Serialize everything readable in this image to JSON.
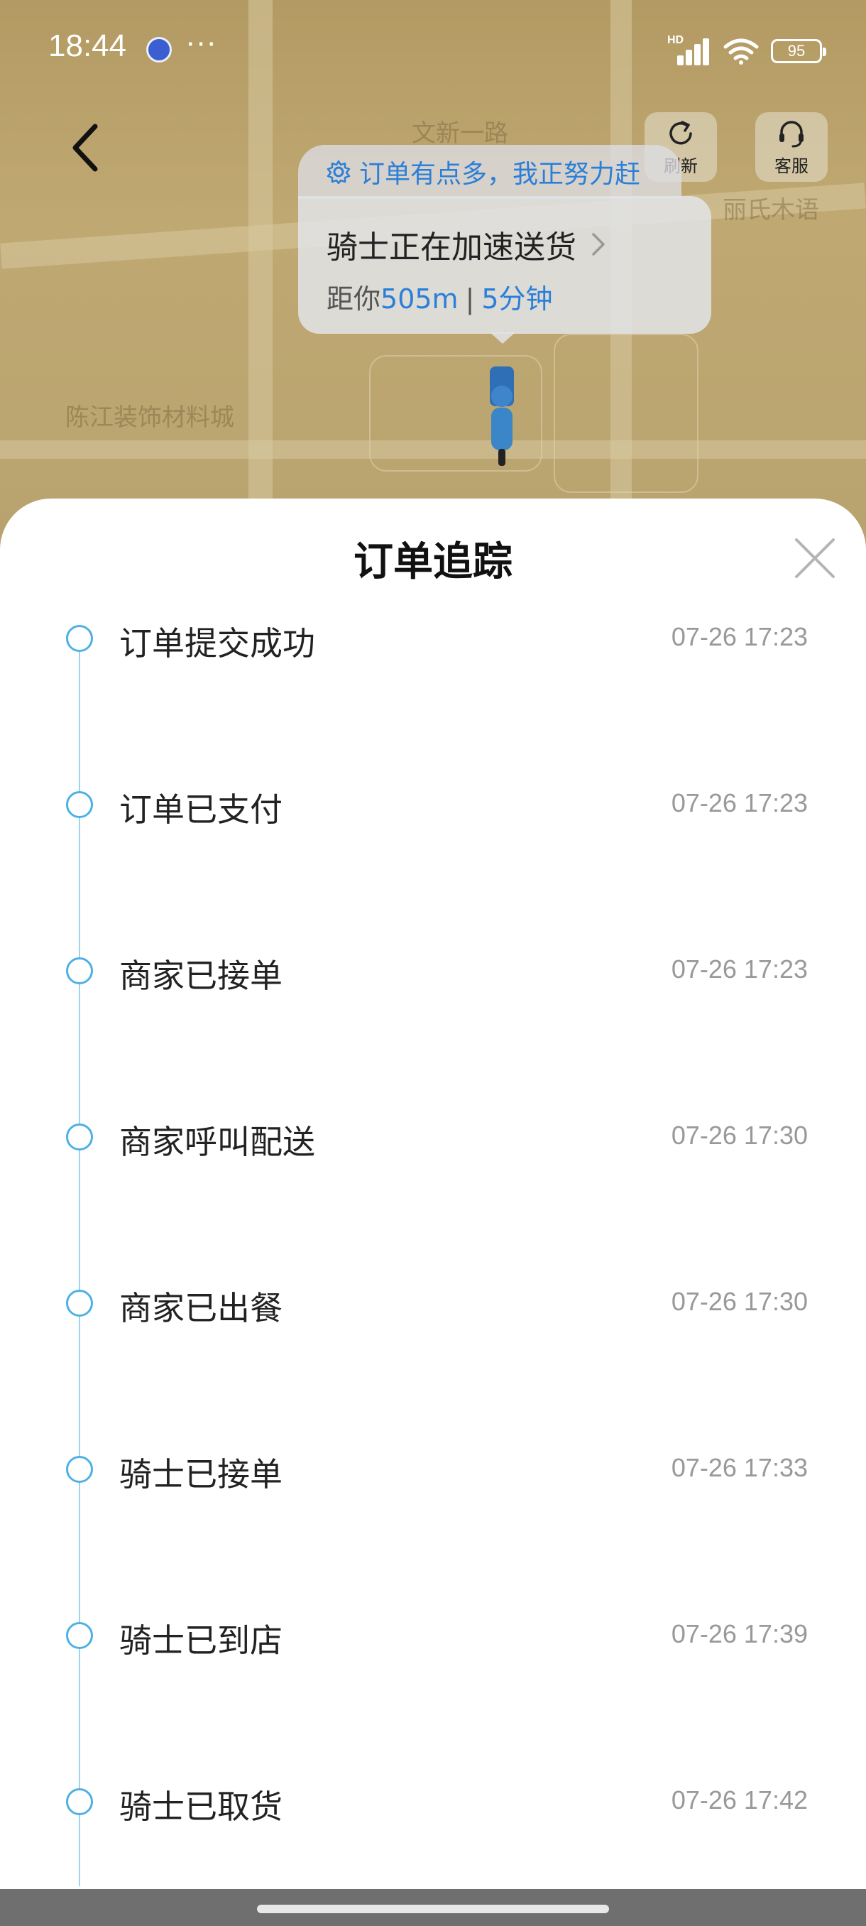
{
  "status_bar": {
    "time": "18:44",
    "dots": "···",
    "network_label": "HD",
    "battery_level": "95"
  },
  "map": {
    "labels": [
      "陈江装饰材料城",
      "丽氏木语",
      "文新一路"
    ]
  },
  "header": {
    "refresh_label": "刷新",
    "service_label": "客服"
  },
  "notice": {
    "text": "订单有点多，我正努力赶"
  },
  "rider_card": {
    "title": "骑士正在加速送货",
    "distance_prefix": "距你",
    "distance": "505m",
    "separator": "|",
    "eta": "5分钟"
  },
  "sheet": {
    "title": "订单追踪",
    "steps": [
      {
        "label": "订单提交成功",
        "time": "07-26 17:23"
      },
      {
        "label": "订单已支付",
        "time": "07-26 17:23"
      },
      {
        "label": "商家已接单",
        "time": "07-26 17:23"
      },
      {
        "label": "商家呼叫配送",
        "time": "07-26 17:30"
      },
      {
        "label": "商家已出餐",
        "time": "07-26 17:30"
      },
      {
        "label": "骑士已接单",
        "time": "07-26 17:33"
      },
      {
        "label": "骑士已到店",
        "time": "07-26 17:39"
      },
      {
        "label": "骑士已取货",
        "time": "07-26 17:42"
      }
    ]
  },
  "colors": {
    "accent": "#2b7fd8",
    "timeline": "#4fb0e4"
  }
}
